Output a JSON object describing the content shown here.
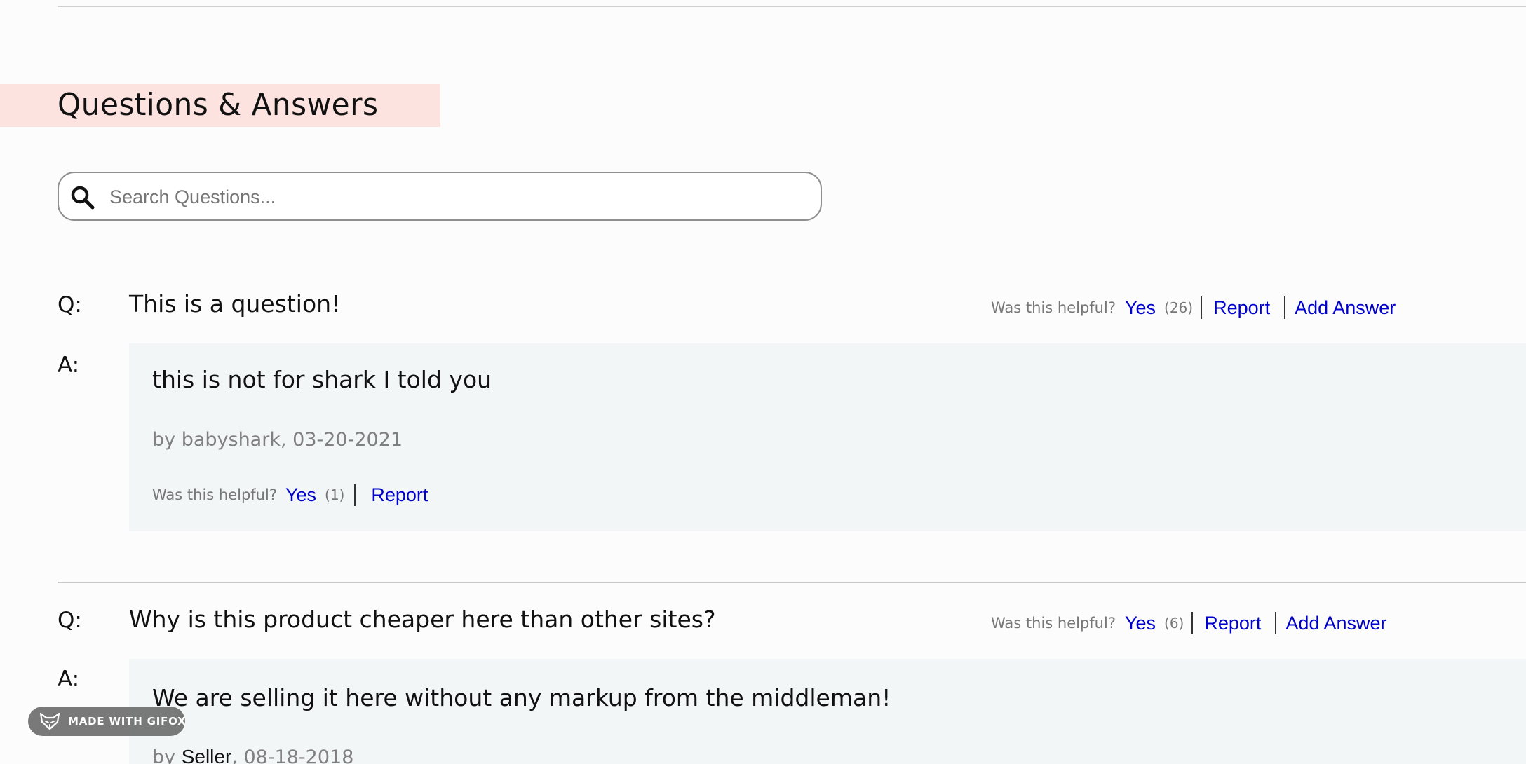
{
  "section": {
    "title": "Questions & Answers"
  },
  "search": {
    "placeholder": "Search Questions...",
    "value": ""
  },
  "questions": [
    {
      "q_marker": "Q:",
      "text": "This is a question!",
      "helpful_label": "Was this helpful?",
      "yes_label": "Yes",
      "yes_count": "(26)",
      "report_label": "Report",
      "add_answer_label": "Add Answer",
      "answer": {
        "a_marker": "A:",
        "text": "this is not for shark I told you",
        "by_prefix": "by ",
        "author": "babyshark",
        "date_sep": ", ",
        "date": "03-20-2021",
        "helpful_label": "Was this helpful?",
        "yes_label": "Yes",
        "yes_count": "(1)",
        "report_label": "Report"
      }
    },
    {
      "q_marker": "Q:",
      "text": "Why is this product cheaper here than other sites?",
      "helpful_label": "Was this helpful?",
      "yes_label": "Yes",
      "yes_count": "(6)",
      "report_label": "Report",
      "add_answer_label": "Add Answer",
      "answer": {
        "a_marker": "A:",
        "text": "We are selling it here without any markup from the middleman!",
        "by_prefix": "by ",
        "author": "Seller",
        "date_sep": ", ",
        "date": "08-18-2018"
      }
    }
  ],
  "overlay": {
    "gifox_label": "MADE WITH GIFOX"
  },
  "colors": {
    "link": "#0000cc",
    "title_highlight": "#fce3df",
    "answer_panel": "#f3f6f6",
    "muted_text": "#777777"
  },
  "icons": {
    "search": "magnifying-glass",
    "gifox": "fox-head"
  }
}
